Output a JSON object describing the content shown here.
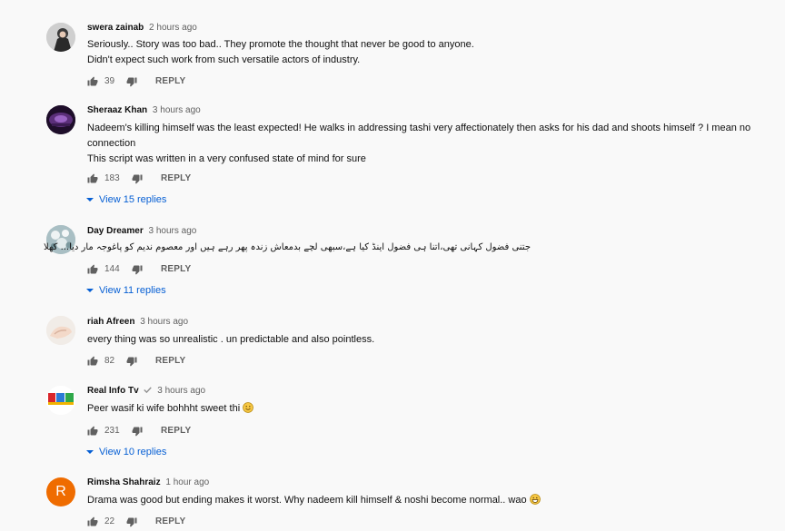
{
  "colors": {
    "background": "#f9f9f9",
    "link": "#065fd4",
    "muted": "#606060"
  },
  "comments": [
    {
      "author": "swera zainab",
      "time": "2 hours ago",
      "text": [
        "Seriously.. Story was too bad.. They promote the thought that never be good to anyone.",
        "Didn't expect such work from such versatile actors of industry."
      ],
      "likes": "39",
      "reply_label": "REPLY"
    },
    {
      "author": "Sheraaz Khan",
      "time": "3 hours ago",
      "text": [
        "Nadeem's killing  himself was the least expected! He walks in addressing  tashi very affectionately  then asks for his dad and shoots himself ? I mean no",
        "connection",
        "This script was written in a very confused state of mind for sure"
      ],
      "likes": "183",
      "reply_label": "REPLY",
      "view_replies": "View 15 replies"
    },
    {
      "author": "Day Dreamer",
      "time": "3 hours ago",
      "text": [
        "جتنی فضول کہانی تھی،اتنا ہی فضول اینڈ کیا ہے،سبھی لچے بدمعاش زندہ پھر رہے ہیں اور معصوم ندیم کو پاغوجہ مار دیا... کھلا"
      ],
      "emoji_icon": "raised-hand-emoji",
      "likes": "144",
      "reply_label": "REPLY",
      "view_replies": "View 11 replies"
    },
    {
      "author": "riah Afreen",
      "time": "3 hours ago",
      "text": [
        "every thing  was so unrealistic .  un predictable and also pointless."
      ],
      "likes": "82",
      "reply_label": "REPLY"
    },
    {
      "author": "Real Info Tv",
      "time": "3 hours ago",
      "verified": true,
      "text": [
        "Peer wasif ki wife bohhht sweet thi"
      ],
      "emoji_icon": "smiling-face-emoji",
      "likes": "231",
      "reply_label": "REPLY",
      "view_replies": "View 10 replies"
    },
    {
      "author": "Rimsha Shahraiz",
      "time": "1 hour ago",
      "avatar_letter": "R",
      "text": [
        "Drama was good but ending makes it worst. Why nadeem kill himself & noshi become normal.. wao"
      ],
      "emoji_icon": "grinning-face-emoji",
      "likes": "22",
      "reply_label": "REPLY"
    }
  ]
}
